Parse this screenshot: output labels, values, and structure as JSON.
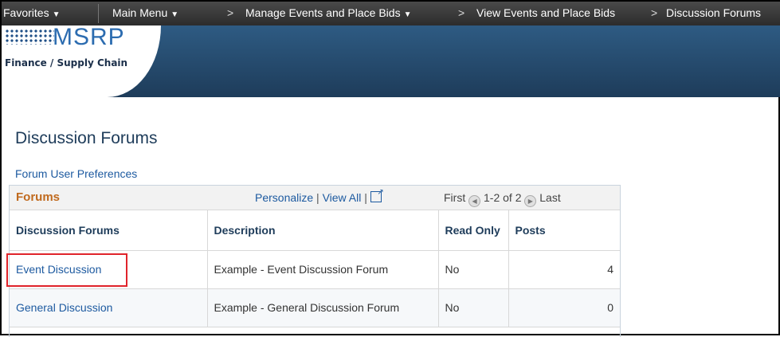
{
  "topnav": {
    "favorites": "Favorites",
    "main_menu": "Main Menu",
    "crumb1": "Manage Events and Place Bids",
    "crumb2": "View Events and Place Bids",
    "crumb3": "Discussion Forums",
    "separator": ">"
  },
  "logo": {
    "name": "MSRP",
    "subtitle": "Finance / Supply Chain"
  },
  "page": {
    "title": "Discussion Forums",
    "pref_link": "Forum User Preferences"
  },
  "grid": {
    "title": "Forums",
    "personalize": "Personalize",
    "view_all": "View All",
    "bar": "|",
    "first": "First",
    "range": "1-2 of 2",
    "last": "Last",
    "columns": [
      "Discussion Forums",
      "Description",
      "Read Only",
      "Posts"
    ],
    "rows": [
      {
        "forum": "Event Discussion",
        "description": "Example - Event Discussion Forum",
        "read_only": "No",
        "posts": "4"
      },
      {
        "forum": "General Discussion",
        "description": "Example - General Discussion Forum",
        "read_only": "No",
        "posts": "0"
      }
    ]
  },
  "colors": {
    "banner": "#2e5b83",
    "link": "#1d5aa0",
    "grid_title": "#c06a1e",
    "highlight": "#e0242b"
  }
}
